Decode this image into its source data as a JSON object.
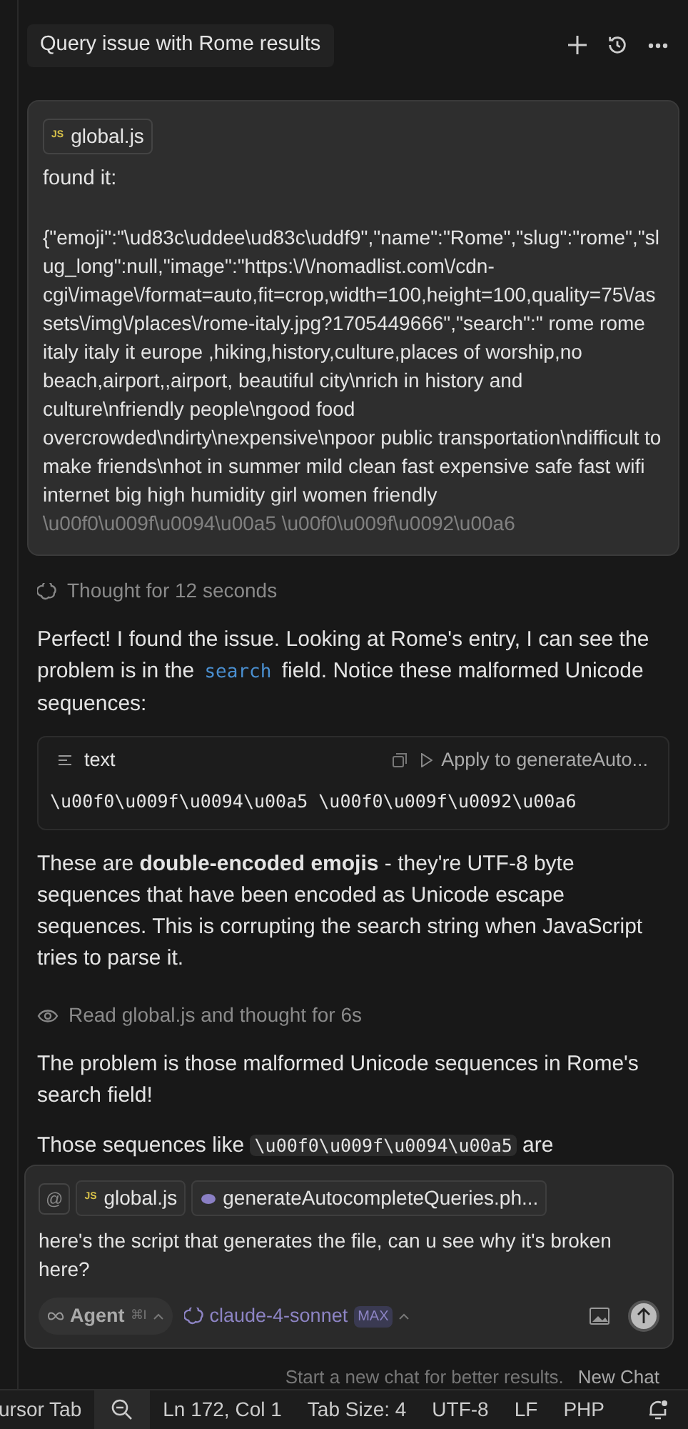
{
  "chat_title": "Query issue with Rome results",
  "user_message": {
    "attachment": "global.js",
    "attachment_badge": "JS",
    "intro": "found it:",
    "body": "{\"emoji\":\"\\ud83c\\uddee\\ud83c\\uddf9\",\"name\":\"Rome\",\"slug\":\"rome\",\"slug_long\":null,\"image\":\"https:\\/\\/nomadlist.com\\/cdn-cgi\\/image\\/format=auto,fit=crop,width=100,height=100,quality=75\\/assets\\/img\\/places\\/rome-italy.jpg?1705449666\",\"search\":\" rome rome italy   italy it europe ,hiking,history,culture,places of worship,no beach,airport,,airport, beautiful city\\nrich in history and culture\\nfriendly people\\ngood food overcrowded\\ndirty\\nexpensive\\npoor public transportation\\ndifficult to make friends\\nhot in summer mild clean fast expensive safe fast wifi internet big high humidity girl women friendly  \\u00f0\\u009f\\u0094\\u00a5 \\u00f0\\u009f\\u0092\\u00a6"
  },
  "thread": [
    {
      "kind": "thought",
      "text": "Thought for 12 seconds"
    },
    {
      "kind": "paragraph",
      "segments": [
        {
          "kind": "text",
          "text": "Perfect! I found the issue. Looking at Rome's entry, I can see the problem is in the "
        },
        {
          "kind": "code",
          "text": "search"
        },
        {
          "kind": "text",
          "text": " field. Notice these malformed Unicode sequences:"
        }
      ]
    },
    {
      "kind": "codeblock",
      "language": "text",
      "action": "Apply to generateAuto...",
      "code": "\\u00f0\\u009f\\u0094\\u00a5 \\u00f0\\u009f\\u0092\\u00a6"
    },
    {
      "kind": "paragraph",
      "segments": [
        {
          "kind": "text",
          "text": "These are **double-encoded emojis** - they're UTF-8 byte sequences that have been encoded as Unicode escape sequences. This is corrupting the search string when JavaScript tries to parse it."
        }
      ]
    },
    {
      "kind": "read",
      "text": "Read global.js and thought for 6s"
    },
    {
      "kind": "paragraph",
      "segments": [
        {
          "kind": "text",
          "text": "The problem is those malformed Unicode sequences in Rome's search field!"
        }
      ]
    },
    {
      "kind": "paragraph",
      "segments": [
        {
          "kind": "text",
          "text": "Those sequences like "
        },
        {
          "kind": "chip",
          "text": "\\u00f0\\u009f\\u0094\\u00a5"
        },
        {
          "kind": "text",
          "text": " are"
        }
      ]
    }
  ],
  "composer": {
    "mention": "@",
    "context": [
      {
        "kind": "js",
        "badge": "JS",
        "label": "global.js"
      },
      {
        "kind": "php",
        "label": "generateAutocompleteQueries.ph..."
      }
    ],
    "value": "here's the script that generates the file, can u see why it's broken here?",
    "mode": "Agent",
    "shortcut": "⌘I",
    "model": "claude-4-sonnet",
    "model_badge": "MAX"
  },
  "hint": "Start a new chat for better results.",
  "new_chat": "New Chat",
  "status_bar": [
    "ursor Tab",
    "Ln 172, Col 1",
    "Tab Size: 4",
    "UTF-8",
    "LF",
    "PHP"
  ]
}
